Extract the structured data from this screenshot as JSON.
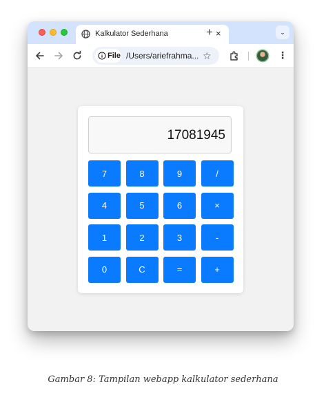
{
  "browser": {
    "tab": {
      "title": "Kalkulator Sederhana",
      "close_label": "×"
    },
    "new_tab_label": "+",
    "tab_menu_label": "⌄",
    "omnibox": {
      "chip_label": "File",
      "url": "/Users/ariefrahma..."
    },
    "star_label": "☆",
    "menu_label": "⋮"
  },
  "calculator": {
    "display_value": "17081945",
    "keys": [
      {
        "label": "7"
      },
      {
        "label": "8"
      },
      {
        "label": "9"
      },
      {
        "label": "/"
      },
      {
        "label": "4"
      },
      {
        "label": "5"
      },
      {
        "label": "6"
      },
      {
        "label": "×"
      },
      {
        "label": "1"
      },
      {
        "label": "2"
      },
      {
        "label": "3"
      },
      {
        "label": "-"
      },
      {
        "label": "0"
      },
      {
        "label": "C"
      },
      {
        "label": "="
      },
      {
        "label": "+"
      }
    ],
    "colors": {
      "key_bg": "#0a7bff",
      "key_text": "#ffffff"
    }
  },
  "caption": "Gambar 8: Tampilan webapp kalkulator sederhana"
}
